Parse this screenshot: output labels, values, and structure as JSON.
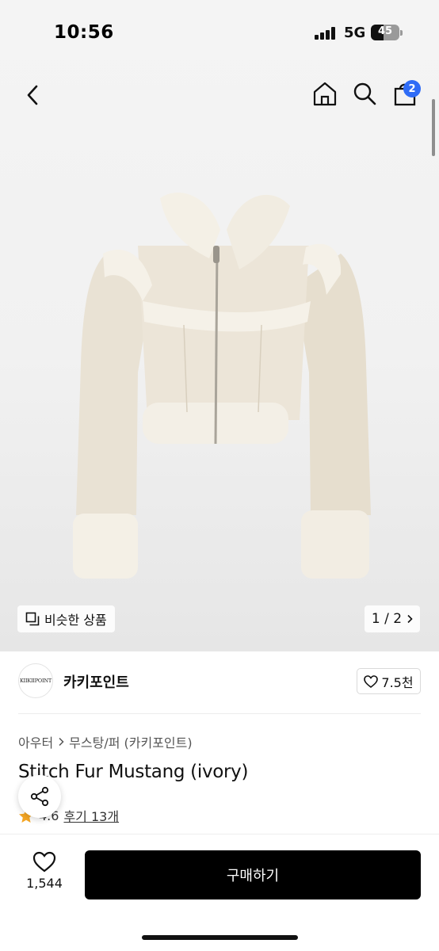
{
  "status_bar": {
    "time": "10:56",
    "network": "5G",
    "battery": "45",
    "battery_level": 0.45
  },
  "nav": {
    "back_icon": "chevron-left-icon",
    "home_icon": "home-icon",
    "search_icon": "search-icon",
    "cart_icon": "shopping-bag-icon",
    "cart_badge": "2"
  },
  "gallery": {
    "similar_label": "비슷한 상품",
    "pager": "1 / 2"
  },
  "brand": {
    "logo_text": "KIIKIIPOINT",
    "name": "카키포인트",
    "likes": "7.5천"
  },
  "product": {
    "breadcrumb": [
      "아우터",
      "무스탕/퍼 (카키포인트)"
    ],
    "title": "Stitch Fur Mustang (ivory)",
    "rating": "4.6",
    "reviews": "후기 13개"
  },
  "bottom": {
    "wish_count": "1,544",
    "buy_label": "구매하기"
  },
  "colors": {
    "accent": "#2f6cf6",
    "button": "#000000",
    "star": "#f5a623",
    "jacket": "#e9e2d4"
  }
}
